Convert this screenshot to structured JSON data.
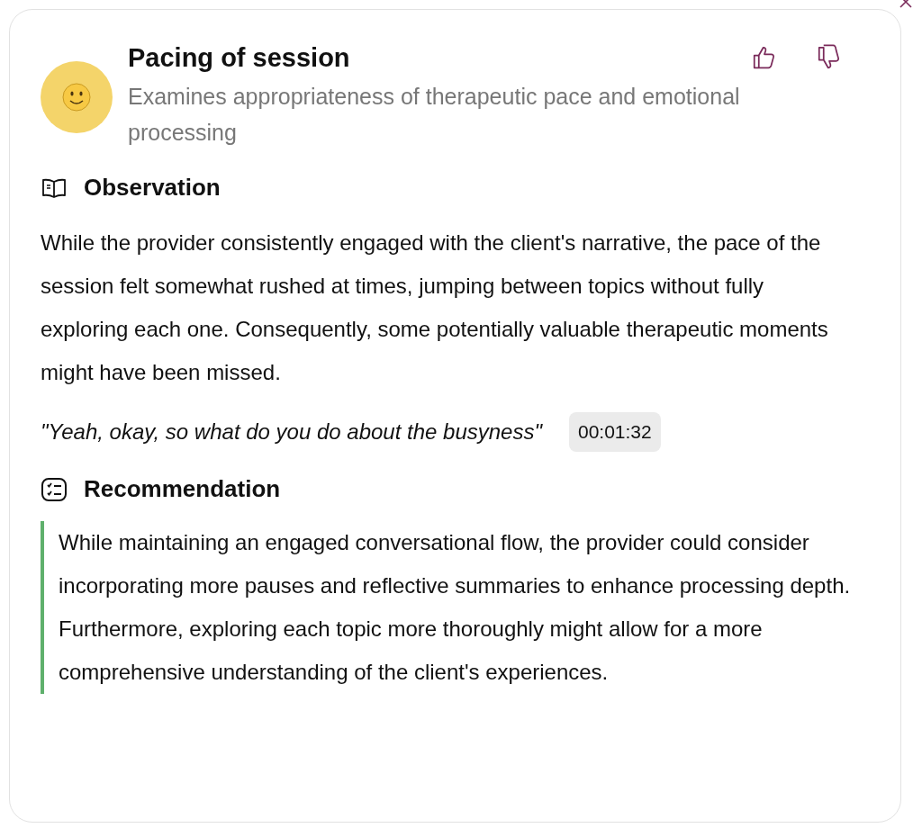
{
  "card": {
    "title": "Pacing of session",
    "subtitle": "Examines appropriateness of therapeutic pace and emotional processing"
  },
  "observation": {
    "heading": "Observation",
    "text": "While the provider consistently engaged with the client's narrative, the pace of the session felt somewhat rushed at times, jumping between topics without fully exploring each one. Consequently, some potentially valuable therapeutic moments might have been missed.",
    "quote": "\"Yeah, okay, so what do you do about the busyness\"",
    "timestamp": "00:01:32"
  },
  "recommendation": {
    "heading": "Recommendation",
    "text": "While maintaining an engaged conversational flow, the provider could consider incorporating more pauses and reflective summaries to enhance processing depth. Furthermore, exploring each topic more thoroughly might allow for a more comprehensive understanding of the client's experiences."
  }
}
